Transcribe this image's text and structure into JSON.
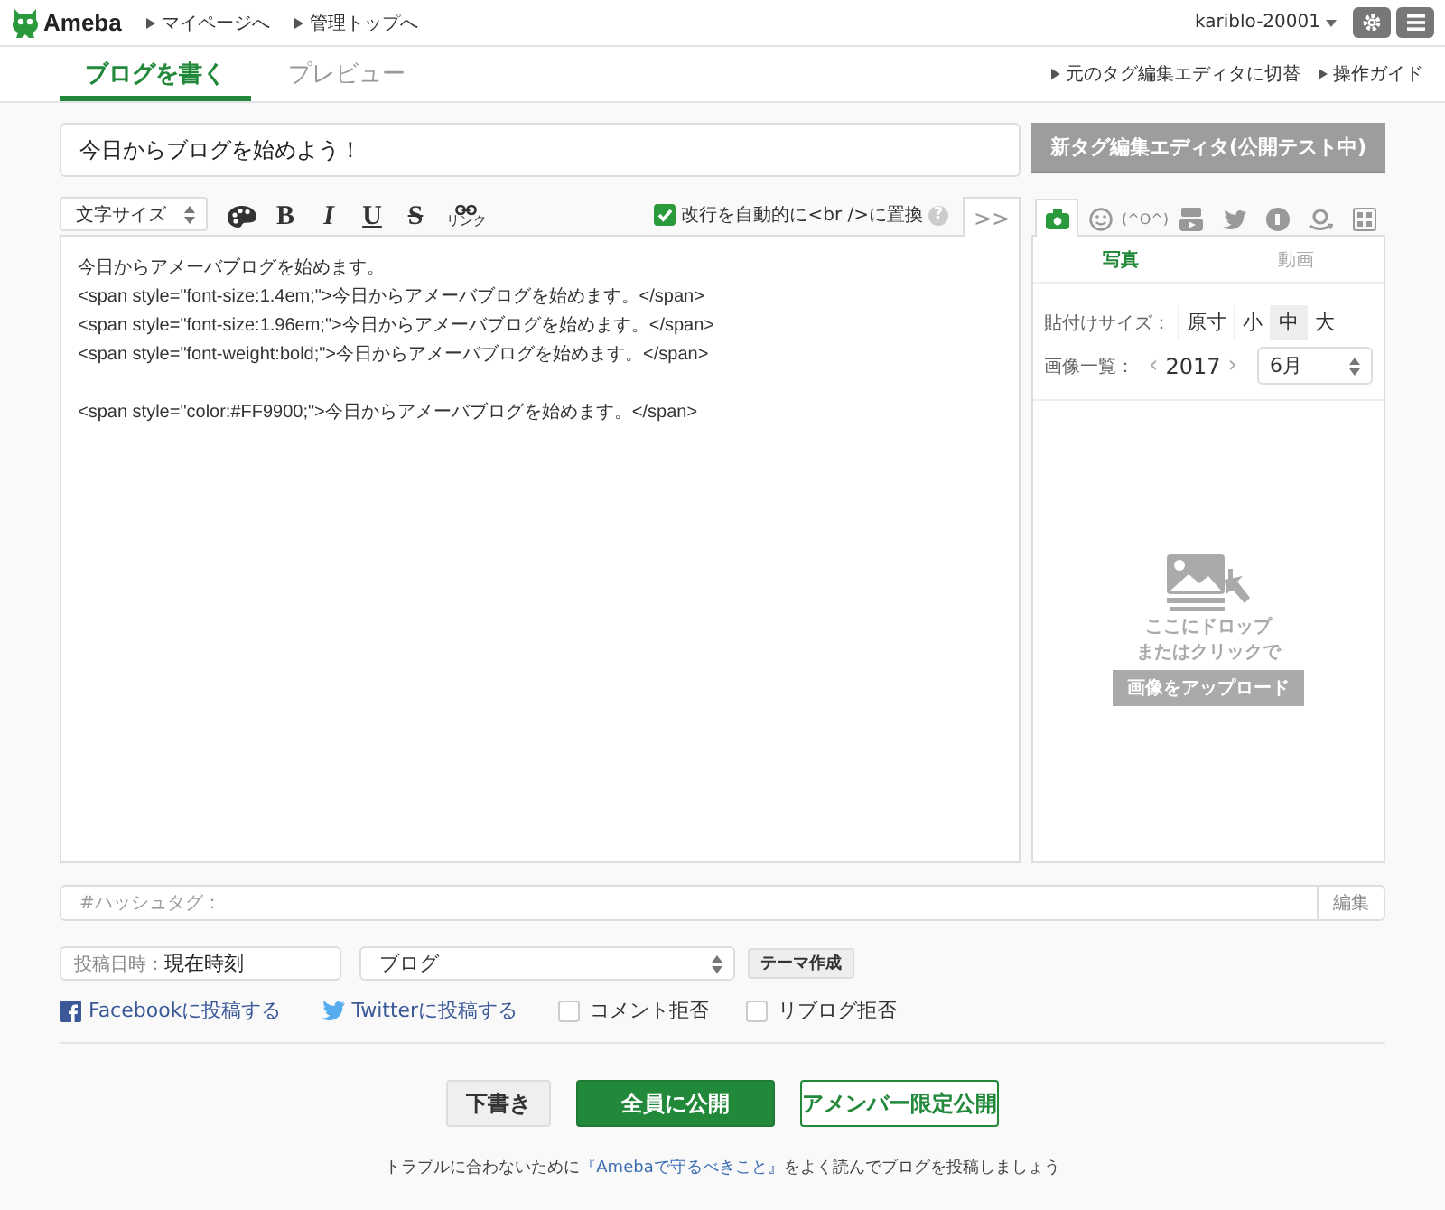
{
  "header": {
    "logo": "Ameba",
    "links": [
      "マイページへ",
      "管理トップへ"
    ],
    "user": "kariblo-20001"
  },
  "tabs": [
    {
      "label": "ブログを書く",
      "selected": true
    },
    {
      "label": "プレビュー",
      "selected": false
    }
  ],
  "header_links": [
    "元のタグ編集エディタに切替",
    "操作ガイド"
  ],
  "title_field": {
    "value": "今日からブログを始めよう！"
  },
  "new_editor_button": "新タグ編集エディタ(公開テスト中)",
  "toolbar": {
    "font_size_select": "文字サイズ",
    "buttons": [
      {
        "kind": "palette"
      },
      {
        "kind": "bold",
        "label": "B"
      },
      {
        "kind": "italic",
        "label": "I"
      },
      {
        "kind": "underline",
        "label": "U"
      },
      {
        "kind": "strike",
        "label": "S"
      },
      {
        "kind": "link",
        "label": "リンク"
      }
    ],
    "auto_br": {
      "label": "改行を自動的に<br />に置換",
      "checked": true
    },
    "help": "?",
    "toggle": ">>"
  },
  "editor": {
    "blocks": [
      [
        "今日からアメーバブログを始めます。",
        "<span style=\"font-size:1.4em;\">今日からアメーバブログを始めます。</span>",
        "<span style=\"font-size:1.96em;\">今日からアメーバブログを始めます。</span>",
        "<span style=\"font-weight:bold;\">今日からアメーバブログを始めます。</span>"
      ],
      [
        "<span style=\"color:#FF9900;\">今日からアメーバブログを始めます。</span>"
      ]
    ]
  },
  "media_panel": {
    "tabs": [
      {
        "kind": "camera",
        "selected": true
      },
      {
        "kind": "smiley",
        "selected": false
      },
      {
        "kind": "text",
        "label": "(^O^)",
        "selected": false
      },
      {
        "kind": "video",
        "selected": false
      },
      {
        "kind": "bird",
        "selected": false
      },
      {
        "kind": "round",
        "selected": false
      },
      {
        "kind": "smile",
        "selected": false
      },
      {
        "kind": "grid",
        "selected": false
      }
    ],
    "subtabs": [
      {
        "label": "写真",
        "selected": true
      },
      {
        "label": "動画",
        "selected": false
      }
    ],
    "size_label": "貼付けサイズ：",
    "sizes": [
      {
        "label": "原寸",
        "selected": false
      },
      {
        "label": "小",
        "selected": false
      },
      {
        "label": "中",
        "selected": true
      },
      {
        "label": "大",
        "selected": false
      }
    ],
    "list_label": "画像一覧：",
    "prev": "‹",
    "year": "2017",
    "next": "›",
    "month": "6月",
    "drop_text": [
      "ここにドロップ",
      "またはクリックで"
    ],
    "upload_button": "画像をアップロード"
  },
  "hashtag": {
    "placeholder": "#ハッシュタグ：",
    "button": "編集"
  },
  "post_date": {
    "label": "投稿日時：",
    "value": "現在時刻"
  },
  "theme_select": "ブログ",
  "theme_button": "テーマ作成",
  "share": [
    {
      "kind": "facebook",
      "label": "Facebookに投稿する"
    },
    {
      "kind": "twitter",
      "label": "Twitterに投稿する"
    }
  ],
  "options": [
    {
      "label": "コメント拒否",
      "checked": false
    },
    {
      "label": "リブログ拒否",
      "checked": false
    }
  ],
  "actions": [
    {
      "kind": "draft",
      "label": "下書き"
    },
    {
      "kind": "primary",
      "label": "全員に公開"
    },
    {
      "kind": "outline",
      "label": "アメンバー限定公開"
    }
  ],
  "footer_note": {
    "before": "トラブルに合わないために",
    "link": "『Amebaで守るべきこと』",
    "after": "をよく読んでブログを投稿しましょう"
  }
}
